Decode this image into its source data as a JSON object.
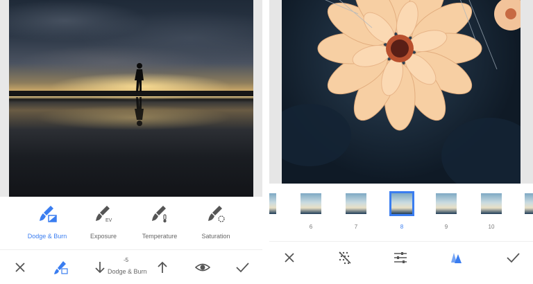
{
  "left_screen": {
    "tools": [
      {
        "label": "Dodge & Burn",
        "icon": "dodge-burn-icon",
        "active": true
      },
      {
        "label": "Exposure",
        "icon": "exposure-brush-icon",
        "badge": "EV",
        "active": false
      },
      {
        "label": "Temperature",
        "icon": "temperature-brush-icon",
        "active": false
      },
      {
        "label": "Saturation",
        "icon": "saturation-brush-icon",
        "active": false
      }
    ],
    "adjustment": {
      "value": "-5",
      "name": "Dodge & Burn"
    },
    "bottom_icons": [
      "close-icon",
      "brush-icon",
      "arrow-down-icon",
      "arrow-up-icon",
      "eye-icon",
      "check-icon"
    ]
  },
  "right_screen": {
    "filters": [
      {
        "number": "",
        "partial": true
      },
      {
        "number": "6"
      },
      {
        "number": "7"
      },
      {
        "number": "8",
        "active": true
      },
      {
        "number": "9"
      },
      {
        "number": "10"
      }
    ],
    "bottom_icons": [
      "close-icon",
      "texture-icon",
      "sliders-icon",
      "styles-icon",
      "check-icon"
    ]
  },
  "colors": {
    "accent": "#3a7df0",
    "icon_gray": "#555555",
    "label_gray": "#666666"
  }
}
